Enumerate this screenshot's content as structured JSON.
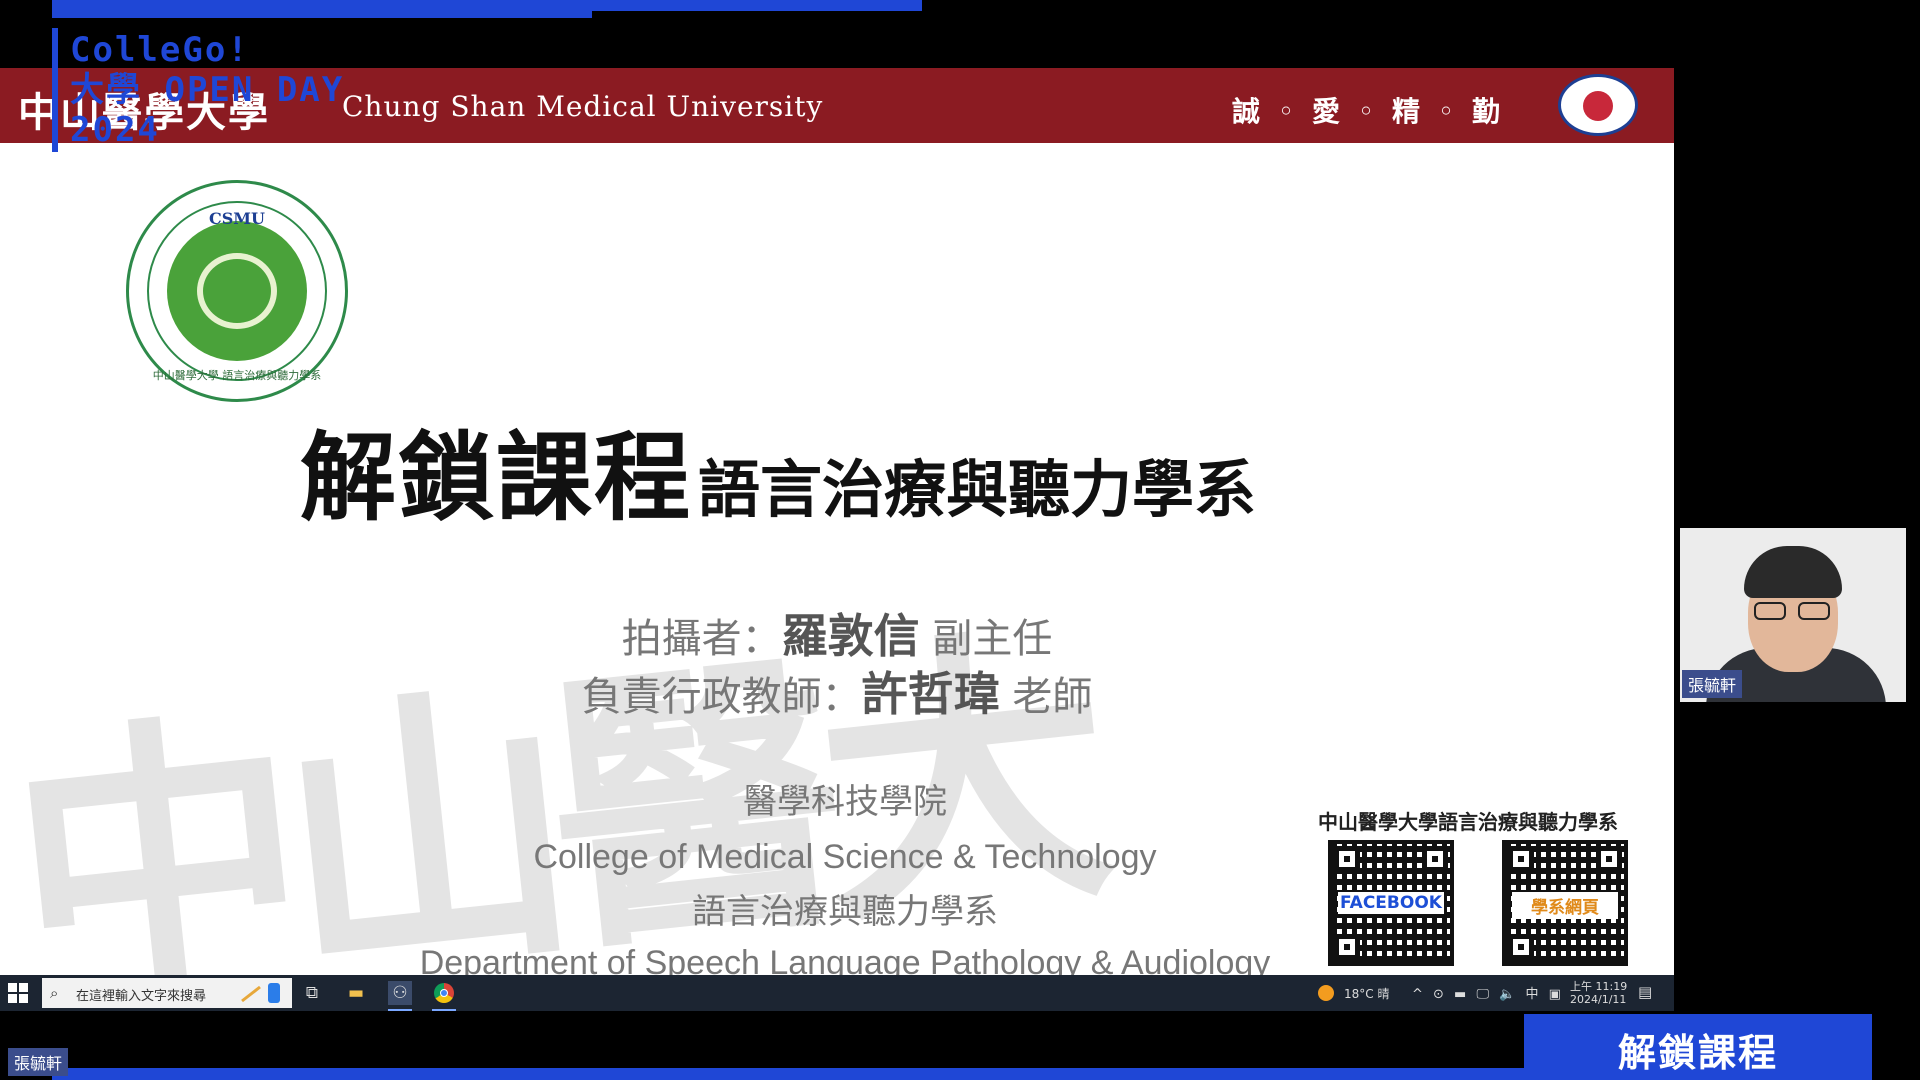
{
  "overlay": {
    "brand_line1": "ColleGo!",
    "brand_line2": "大學 OPEN DAY",
    "brand_line3": "2024",
    "caption": "解鎖課程",
    "user_tag": "張毓軒"
  },
  "slide": {
    "header": {
      "university_cn": "中山醫學大學",
      "university_en": "Chung Shan Medical University",
      "motto": "誠 ◦ 愛 ◦ 精 ◦ 勤"
    },
    "logo": {
      "top_text": "CSMU",
      "bottom_text": "中山醫學大學 語言治療與聽力學系"
    },
    "title_main": "解鎖課程",
    "title_sub": "語言治療與聽力學系",
    "credits": {
      "photographer_prefix": "拍攝者：",
      "photographer_name": "羅敦信",
      "photographer_title": " 副主任",
      "admin_prefix": "負責行政教師：",
      "admin_name": "許哲瑋",
      "admin_title": " 老師"
    },
    "college_cn": "醫學科技學院",
    "college_en": "College of Medical Science & Technology",
    "dept_cn": "語言治療與聽力學系",
    "dept_en": "Department of Speech Language Pathology & Audiology",
    "watermark": "中山醫大",
    "qr": {
      "title": "中山醫學大學語言治療與聽力學系",
      "facebook_label": "FACEBOOK",
      "web_label": "學系網頁"
    }
  },
  "taskbar": {
    "search_placeholder": "在這裡輸入文字來搜尋",
    "weather": "18°C 晴",
    "tray": "^ ⊙ ▬ 🖵 🔈 中 ▣",
    "time": "上午 11:19",
    "date": "2024/1/11"
  },
  "webcam": {
    "name": "張毓軒"
  }
}
